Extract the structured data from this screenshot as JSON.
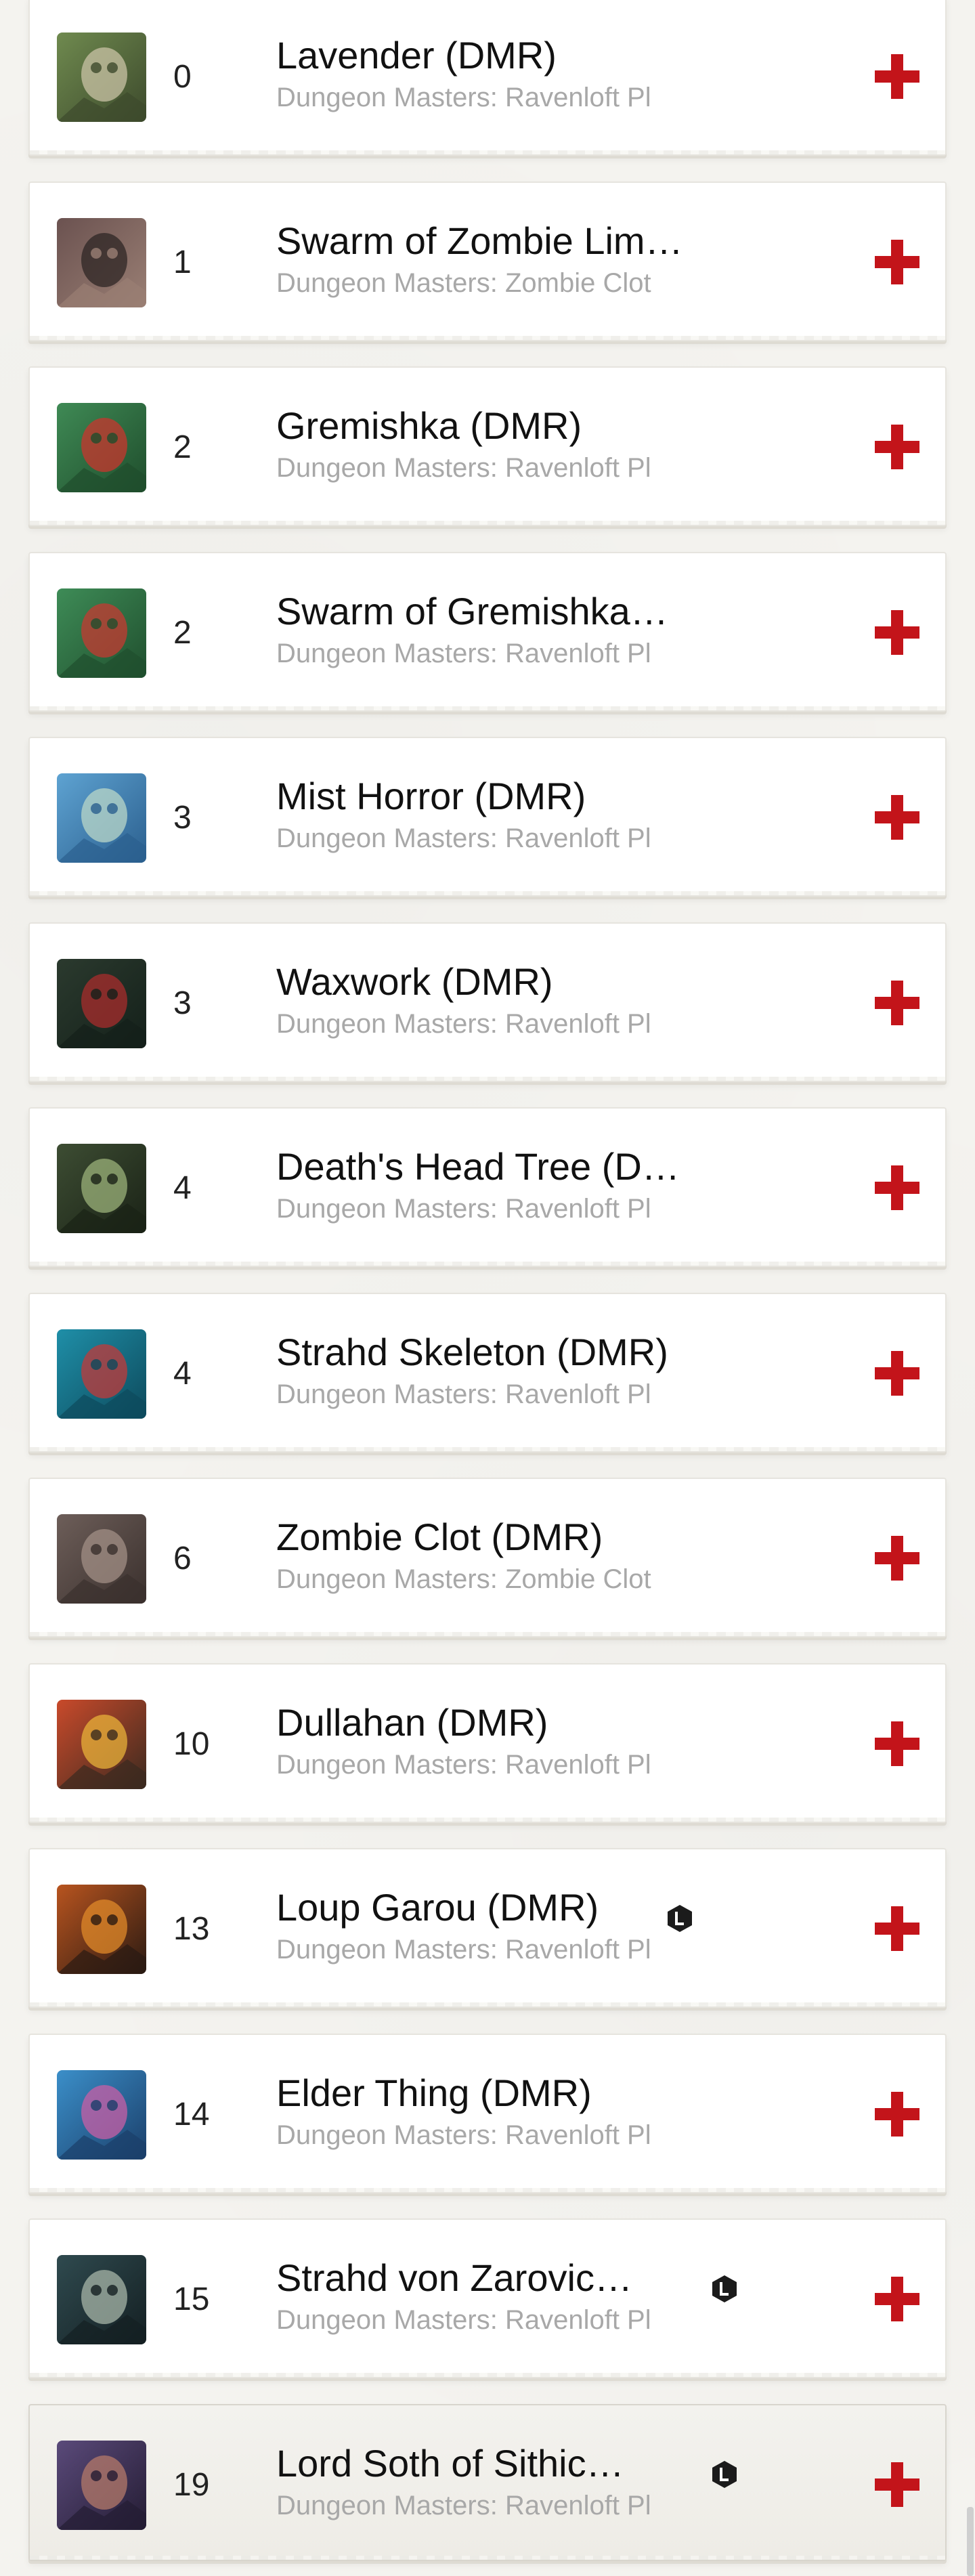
{
  "cards": [
    {
      "cost": "0",
      "name": "Lavender (DMR)",
      "set": "Dungeon Masters: Ravenloft Pl",
      "legendary": false,
      "art": [
        "#6f8a4f",
        "#c9c3a6",
        "#3d4a2c"
      ],
      "highlight": false
    },
    {
      "cost": "1",
      "name": "Swarm of Zombie Lim…",
      "set": "Dungeon Masters: Zombie Clot",
      "legendary": false,
      "art": [
        "#6b5250",
        "#2d2624",
        "#9a7f74"
      ],
      "highlight": false
    },
    {
      "cost": "2",
      "name": "Gremishka (DMR)",
      "set": "Dungeon Masters: Ravenloft Pl",
      "legendary": false,
      "art": [
        "#3f8a55",
        "#c8352e",
        "#1f4d2c"
      ],
      "highlight": false
    },
    {
      "cost": "2",
      "name": "Swarm of Gremishka…",
      "set": "Dungeon Masters: Ravenloft Pl",
      "legendary": false,
      "art": [
        "#3e8c57",
        "#c53a31",
        "#204f2e"
      ],
      "highlight": false
    },
    {
      "cost": "3",
      "name": "Mist Horror (DMR)",
      "set": "Dungeon Masters: Ravenloft Pl",
      "legendary": false,
      "art": [
        "#5ea3d2",
        "#b9d7c8",
        "#2b5f8e"
      ],
      "highlight": false
    },
    {
      "cost": "3",
      "name": "Waxwork (DMR)",
      "set": "Dungeon Masters: Ravenloft Pl",
      "legendary": false,
      "art": [
        "#2b3a2e",
        "#a82c2c",
        "#14201a"
      ],
      "highlight": false
    },
    {
      "cost": "4",
      "name": "Death's Head Tree (D…",
      "set": "Dungeon Masters: Ravenloft Pl",
      "legendary": false,
      "art": [
        "#3d4d33",
        "#9bb27a",
        "#1a2216"
      ],
      "highlight": false
    },
    {
      "cost": "4",
      "name": "Strahd Skeleton (DMR)",
      "set": "Dungeon Masters: Ravenloft Pl",
      "legendary": false,
      "art": [
        "#1f8fa8",
        "#c23a3a",
        "#0d4a5c"
      ],
      "highlight": false
    },
    {
      "cost": "6",
      "name": "Zombie Clot (DMR)",
      "set": "Dungeon Masters: Zombie Clot",
      "legendary": false,
      "art": [
        "#6d5e59",
        "#a28f86",
        "#3a302d"
      ],
      "highlight": false
    },
    {
      "cost": "10",
      "name": "Dullahan (DMR)",
      "set": "Dungeon Masters: Ravenloft Pl",
      "legendary": false,
      "art": [
        "#c94a2b",
        "#e8b23a",
        "#3b2a1f"
      ],
      "highlight": false
    },
    {
      "cost": "13",
      "name": "Loup Garou (DMR)",
      "set": "Dungeon Masters: Ravenloft Pl",
      "legendary": true,
      "art": [
        "#b8541f",
        "#e08a2a",
        "#2a1a12"
      ],
      "highlight": false
    },
    {
      "cost": "14",
      "name": "Elder Thing (DMR)",
      "set": "Dungeon Masters: Ravenloft Pl",
      "legendary": false,
      "art": [
        "#3b8fc9",
        "#c85fa6",
        "#1b3f6a"
      ],
      "highlight": false
    },
    {
      "cost": "15",
      "name": "Strahd von Zarovic…",
      "set": "Dungeon Masters: Ravenloft Pl",
      "legendary": true,
      "art": [
        "#2f4a4f",
        "#a7b6a8",
        "#141f22"
      ],
      "highlight": false
    },
    {
      "cost": "19",
      "name": "Lord Soth of Sithic…",
      "set": "Dungeon Masters: Ravenloft Pl",
      "legendary": true,
      "art": [
        "#5a4a7a",
        "#b47a6a",
        "#241c33"
      ],
      "highlight": true
    }
  ]
}
